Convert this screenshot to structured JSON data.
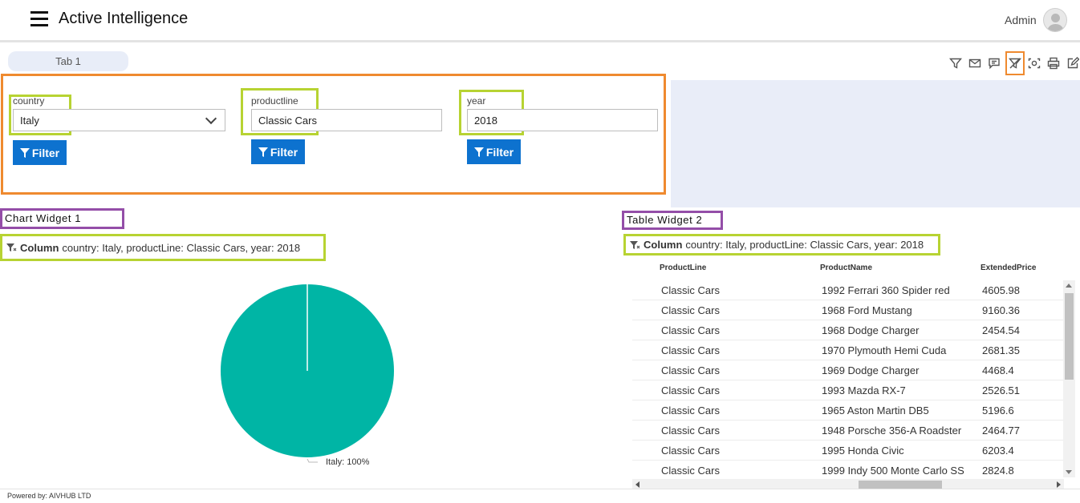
{
  "header": {
    "app_title": "Active Intelligence",
    "user_name": "Admin"
  },
  "tabs": [
    {
      "label": "Tab 1"
    }
  ],
  "toolbar": {
    "icons": [
      "filter-icon",
      "mail-icon",
      "comment-icon",
      "clear-filter-icon",
      "screenshot-icon",
      "print-icon",
      "edit-icon"
    ]
  },
  "filters": {
    "country": {
      "label": "country",
      "value": "Italy"
    },
    "productline": {
      "label": "productline",
      "value": "Classic Cars"
    },
    "year": {
      "label": "year",
      "value": "2018"
    },
    "button_label": "Filter"
  },
  "chart_widget": {
    "title": "Chart Widget 1",
    "filter_kind": "Column",
    "filter_text": "country: Italy, productLine: Classic Cars, year: 2018"
  },
  "chart_data": {
    "type": "pie",
    "slices": [
      {
        "label": "Italy",
        "value": 100,
        "color": "#00b5a5"
      }
    ],
    "data_label": "Italy: 100%"
  },
  "table_widget": {
    "title": "Table Widget 2",
    "filter_kind": "Column",
    "filter_text": "country: Italy, productLine: Classic Cars, year: 2018",
    "columns": [
      "ProductLine",
      "ProductName",
      "ExtendedPrice"
    ],
    "rows": [
      [
        "Classic Cars",
        "1992 Ferrari 360 Spider red",
        "4605.98"
      ],
      [
        "Classic Cars",
        "1968 Ford Mustang",
        "9160.36"
      ],
      [
        "Classic Cars",
        "1968 Dodge Charger",
        "2454.54"
      ],
      [
        "Classic Cars",
        "1970 Plymouth Hemi Cuda",
        "2681.35"
      ],
      [
        "Classic Cars",
        "1969 Dodge Charger",
        "4468.4"
      ],
      [
        "Classic Cars",
        "1993 Mazda RX-7",
        "2526.51"
      ],
      [
        "Classic Cars",
        "1965 Aston Martin DB5",
        "5196.6"
      ],
      [
        "Classic Cars",
        "1948 Porsche 356-A Roadster",
        "2464.77"
      ],
      [
        "Classic Cars",
        "1995 Honda Civic",
        "6203.4"
      ],
      [
        "Classic Cars",
        "1999 Indy 500 Monte Carlo SS",
        "2824.8"
      ]
    ]
  },
  "footer": {
    "text": "Powered by: AIVHUB LTD"
  },
  "colors": {
    "accent": "#0d72cf",
    "highlight_orange": "#ef8a2f",
    "highlight_green": "#b7d332",
    "highlight_purple": "#944ea8",
    "pie": "#00b5a5"
  }
}
